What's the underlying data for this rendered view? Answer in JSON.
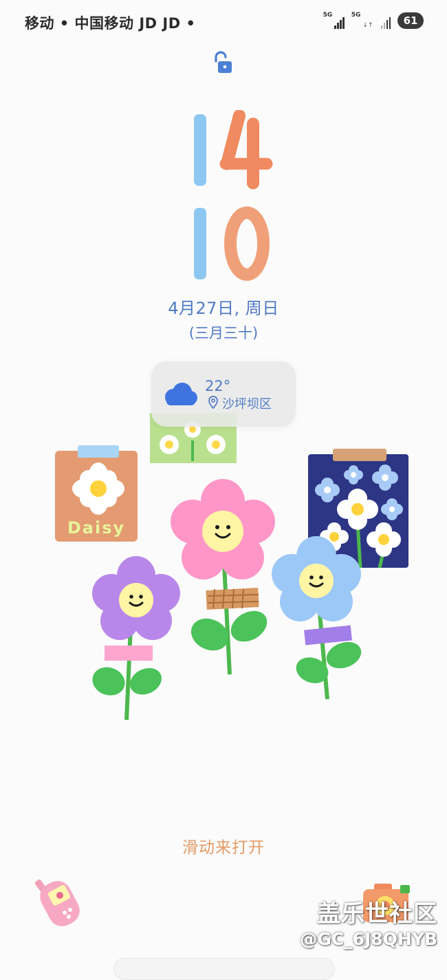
{
  "status_bar": {
    "carrier": "移动 • 中国移动    JD JD •",
    "sim1_network": "5G",
    "sim2_network": "5G",
    "battery": "61"
  },
  "lock_screen": {
    "lock_icon": "unlocked-padlock-icon",
    "clock": {
      "hour": "14",
      "minute": "10",
      "hour_tens_color": "#8cc8f2",
      "hour_ones_color": "#f08a60",
      "minute_tens_color": "#8cc8f2",
      "minute_ones_color": "#f0a078"
    },
    "date": "4月27日, 周日",
    "lunar_date": "(三月三十)",
    "swipe_hint": "滑动来打开"
  },
  "weather": {
    "icon": "cloud-icon",
    "temperature": "22°",
    "location_icon": "location-pin-icon",
    "location": "沙坪坝区"
  },
  "wallpaper": {
    "card_label": "Daisy"
  },
  "shortcuts": {
    "left_icon": "phone-icon",
    "right_icon": "camera-icon"
  },
  "watermark": {
    "title": "盖乐世社区",
    "handle": "@GC_6J8QHYB"
  },
  "colors": {
    "accent_text": "#4f7ac4",
    "swipe_text": "#e39a64"
  }
}
